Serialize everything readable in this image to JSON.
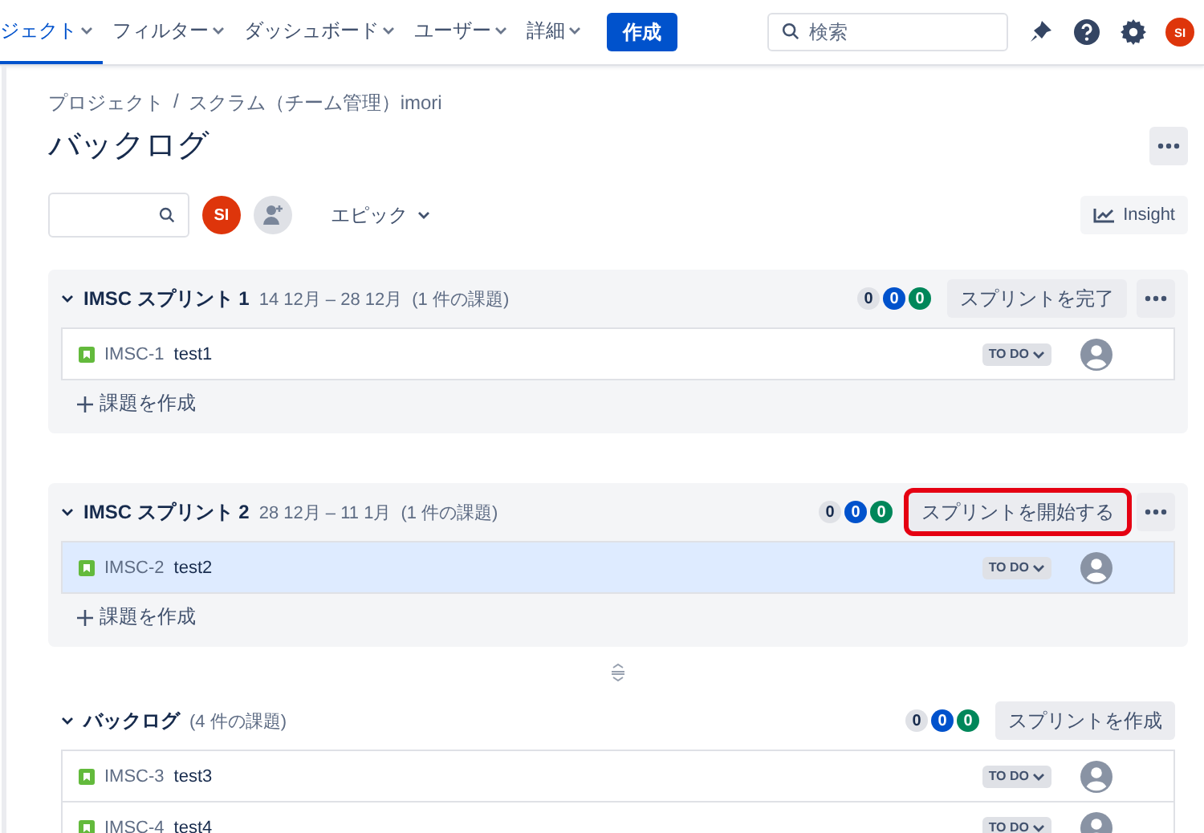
{
  "nav": {
    "items": [
      {
        "label": "ジェクト",
        "selected": true
      },
      {
        "label": "フィルター",
        "selected": false
      },
      {
        "label": "ダッシュボード",
        "selected": false
      },
      {
        "label": "ユーザー",
        "selected": false
      },
      {
        "label": "詳細",
        "selected": false
      }
    ],
    "create_button": "作成",
    "search": {
      "placeholder": "検索"
    },
    "avatar": "SI"
  },
  "breadcrumb": [
    "プロジェクト",
    "スクラム（チーム管理）imori"
  ],
  "breadcrumb_separator": "/",
  "title": "バックログ",
  "toolbar": {
    "avatar": "SI",
    "epic_filter": "エピック",
    "insight_button": "Insight"
  },
  "sections": [
    {
      "kind": "sprint",
      "name": "IMSC スプリント 1",
      "dates": "14 12月 – 28 12月",
      "count": "(1 件の課題)",
      "counts": [
        {
          "value": "0",
          "color": "#dfe1e6"
        },
        {
          "value": "0",
          "color": "#0052cc"
        },
        {
          "value": "0",
          "color": "#00875a"
        }
      ],
      "button": {
        "label": "スプリントを完了",
        "highlighted": false
      },
      "issues": [
        {
          "key": "IMSC-1",
          "summary": "test1",
          "status": "TO DO",
          "selected": false
        }
      ],
      "create_label": "課題を作成"
    },
    {
      "kind": "sprint",
      "name": "IMSC スプリント 2",
      "dates": "28 12月 – 11 1月",
      "count": "(1 件の課題)",
      "counts": [
        {
          "value": "0",
          "color": "#dfe1e6"
        },
        {
          "value": "0",
          "color": "#0052cc"
        },
        {
          "value": "0",
          "color": "#00875a"
        }
      ],
      "button": {
        "label": "スプリントを開始する",
        "highlighted": true
      },
      "issues": [
        {
          "key": "IMSC-2",
          "summary": "test2",
          "status": "TO DO",
          "selected": true
        }
      ],
      "create_label": "課題を作成"
    },
    {
      "kind": "backlog",
      "name": "バックログ",
      "count": "(4 件の課題)",
      "counts": [
        {
          "value": "0",
          "color": "#dfe1e6"
        },
        {
          "value": "0",
          "color": "#0052cc"
        },
        {
          "value": "0",
          "color": "#00875a"
        }
      ],
      "button": {
        "label": "スプリントを作成",
        "highlighted": false
      },
      "issues": [
        {
          "key": "IMSC-3",
          "summary": "test3",
          "status": "TO DO",
          "selected": false
        },
        {
          "key": "IMSC-4",
          "summary": "test4",
          "status": "TO DO",
          "selected": false
        }
      ]
    }
  ]
}
